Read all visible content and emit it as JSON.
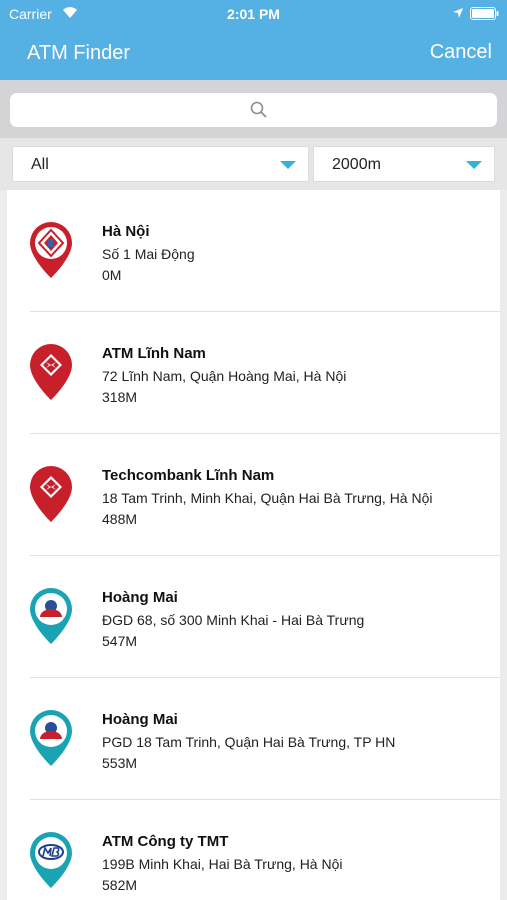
{
  "status_bar": {
    "carrier": "Carrier",
    "time": "2:01 PM"
  },
  "nav": {
    "title": "ATM Finder",
    "cancel_label": "Cancel"
  },
  "search": {
    "placeholder": "",
    "value": ""
  },
  "filters": {
    "type_value": "All",
    "radius_value": "2000m"
  },
  "colors": {
    "header": "#55b0e3",
    "accent": "#2fb3d8",
    "pin_red": "#c8202a",
    "pin_teal": "#1aa3b2"
  },
  "results": [
    {
      "name": "Hà Nội",
      "address": "Số 1 Mai Động",
      "distance": "0M",
      "icon": "agribank-pin-icon"
    },
    {
      "name": "ATM Lĩnh Nam",
      "address": "72 Lĩnh Nam, Quận Hoàng Mai, Hà Nội",
      "distance": "318M",
      "icon": "techcombank-pin-icon"
    },
    {
      "name": "Techcombank Lĩnh Nam",
      "address": "18 Tam Trinh, Minh Khai, Quận Hai Bà Trưng, Hà Nội",
      "distance": "488M",
      "icon": "techcombank-pin-icon"
    },
    {
      "name": "Hoàng Mai",
      "address": "ĐGD 68, số 300 Minh Khai - Hai Bà Trưng",
      "distance": "547M",
      "icon": "bidv-pin-icon"
    },
    {
      "name": "Hoàng Mai",
      "address": "PGD 18 Tam Trinh, Quận Hai Bà Trưng, TP HN",
      "distance": "553M",
      "icon": "bidv-pin-icon"
    },
    {
      "name": "ATM Công ty TMT",
      "address": "199B Minh Khai, Hai Bà Trưng, Hà Nội",
      "distance": "582M",
      "icon": "mbbank-pin-icon"
    }
  ]
}
